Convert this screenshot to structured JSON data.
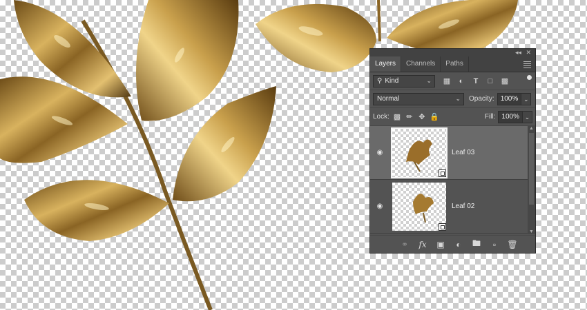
{
  "panel": {
    "tabs": [
      "Layers",
      "Channels",
      "Paths"
    ],
    "filter": {
      "kind_label": "Kind"
    },
    "blend_mode": "Normal",
    "opacity_label": "Opacity:",
    "opacity_value": "100%",
    "lock_label": "Lock:",
    "fill_label": "Fill:",
    "fill_value": "100%",
    "layers": [
      {
        "name": "Leaf 03",
        "selected": true,
        "visible": true
      },
      {
        "name": "Leaf 02",
        "selected": false,
        "visible": true
      }
    ]
  },
  "icons": {
    "titlebar": [
      "collapse-icon",
      "close-icon"
    ],
    "filters": [
      "pixel-filter-icon",
      "adjustment-filter-icon",
      "type-filter-icon",
      "shape-filter-icon",
      "smartobject-filter-icon"
    ],
    "lock": [
      "lock-pixels-icon",
      "lock-paint-icon",
      "lock-position-icon",
      "lock-all-icon"
    ],
    "bottom": [
      "link-icon",
      "fx-icon",
      "mask-icon",
      "adjustment-icon",
      "folder-icon",
      "new-layer-icon",
      "trash-icon"
    ]
  },
  "colors": {
    "gold": "#b8893b",
    "panel": "#535353",
    "selected": "#6a6a6a"
  }
}
